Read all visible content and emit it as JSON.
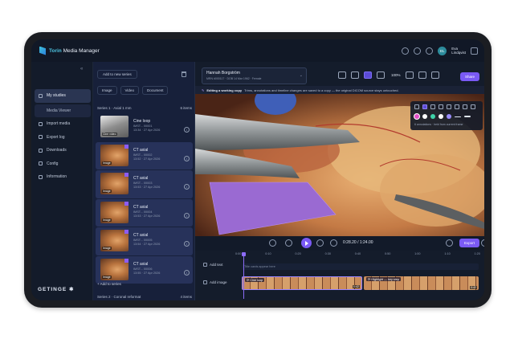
{
  "app": {
    "title_brand": "Torin",
    "title_rest": " Media Manager"
  },
  "user": {
    "initials": "EL",
    "first": "Eva",
    "last": "Lindqvist"
  },
  "sidebar": {
    "items": [
      {
        "label": "My studies"
      },
      {
        "label": "Media Viewer"
      },
      {
        "label": "Import media"
      },
      {
        "label": "Export log"
      },
      {
        "label": "Downloads"
      },
      {
        "label": "Config"
      },
      {
        "label": "Information"
      }
    ],
    "brand": "GETINGE ✱"
  },
  "series_panel": {
    "add_series_top": "Add to new series",
    "tabs": [
      {
        "label": "Image"
      },
      {
        "label": "Video"
      },
      {
        "label": "Document"
      }
    ],
    "series1": {
      "title": "Series 1 · Axial 1 mm",
      "count": "6 items"
    },
    "items": [
      {
        "title": "Cine loop",
        "id": "IMST... 00001",
        "date": "13:34 · 27 Apr 2026",
        "badge": "Cine video",
        "cine": true
      },
      {
        "title": "CT axial",
        "id": "IMST... 00002",
        "date": "13:52 · 27 Apr 2026",
        "badge": "Image",
        "cine": false
      },
      {
        "title": "CT axial",
        "id": "IMST... 00003",
        "date": "13:53 · 27 Apr 2026",
        "badge": "Image",
        "cine": false
      },
      {
        "title": "CT axial",
        "id": "IMST... 00004",
        "date": "13:53 · 27 Apr 2026",
        "badge": "Image",
        "cine": false
      },
      {
        "title": "CT axial",
        "id": "IMST... 00005",
        "date": "13:54 · 27 Apr 2026",
        "badge": "Image",
        "cine": false
      },
      {
        "title": "CT axial",
        "id": "IMST... 00006",
        "date": "13:55 · 27 Apr 2026",
        "badge": "Image",
        "cine": false
      }
    ],
    "add_series_bottom": "Add to series",
    "series2": {
      "title": "Series 2 · Coronal reformat",
      "count": "4 items"
    }
  },
  "patient": {
    "name": "Hannah Borgström",
    "mrn": "MRN #000117",
    "dob": "DOB 14 Mar 1962",
    "sex": "Female"
  },
  "toolbar": {
    "zoom": "100%",
    "share_label": "Share"
  },
  "banner": {
    "title": "Editing a working copy",
    "text": "Trims, annotations and timeline changes are saved to a copy — the original DICOM source stays untouched."
  },
  "annotation": {
    "note": "6 annotations · held from current frame",
    "colors": [
      "#e34fc6",
      "#ffffff",
      "#3fd3a9",
      "#ffffff",
      "#9a8cff"
    ]
  },
  "transport": {
    "time": "0:28.20 / 1:24.00",
    "speed": "1x",
    "export_label": "Export"
  },
  "timeline": {
    "ticks": [
      "0:00",
      "0:10",
      "0:20",
      "0:30",
      "0:40",
      "0:50",
      "1:00",
      "1:10",
      "1:20"
    ],
    "add_text": "Add text",
    "add_image": "Add image",
    "text_placeholder": "Title cards appear here",
    "clips": [
      {
        "label": "Cine loop",
        "duration": "0:42"
      },
      {
        "label": "Highlight — key step",
        "duration": "0:42"
      }
    ]
  }
}
